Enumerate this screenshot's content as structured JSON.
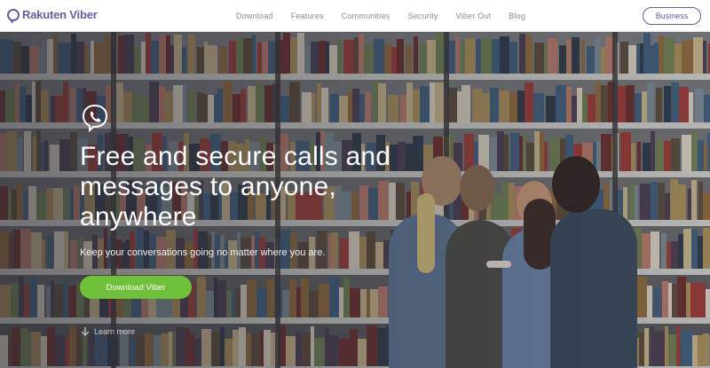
{
  "header": {
    "logo_text": "Rakuten Viber",
    "nav": [
      "Download",
      "Features",
      "Communities",
      "Security",
      "Viber Out",
      "Blog"
    ],
    "business_label": "Business"
  },
  "hero": {
    "title": "Free and secure calls and messages to anyone, anywhere",
    "subtitle": "Keep your conversations going no matter where you are.",
    "download_label": "Download Viber",
    "learn_more_label": "Learn more"
  },
  "colors": {
    "brand_purple": "#665cac",
    "download_green": "#70c13a"
  }
}
